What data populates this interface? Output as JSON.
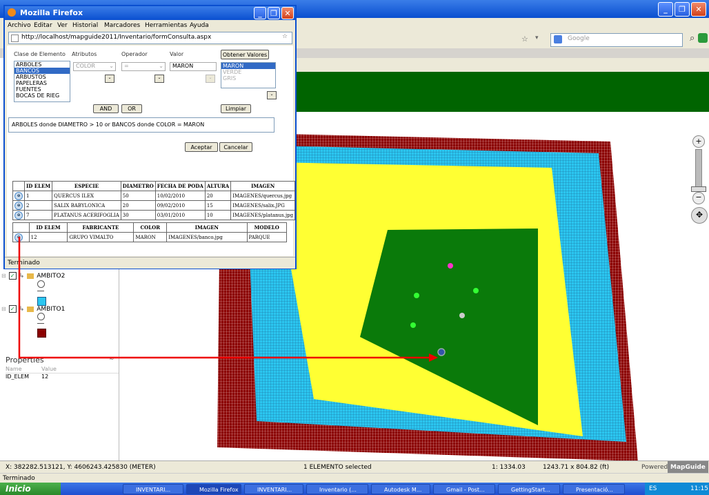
{
  "main_window": {
    "search_placeholder": "Google",
    "status_coords": "X: 382282.513121, Y: 4606243.425830 (METER)",
    "status_selected": "1 ELEMENTO selected",
    "status_scale": "1: 1334.03",
    "status_size": "1243.71 x 804.82 (ft)",
    "powered_by": "Powered by",
    "brand": "MapGuide",
    "bottom_status": "Terminado"
  },
  "legend": {
    "items": [
      {
        "label": "AMBITO2",
        "checked": true
      },
      {
        "label": "AMBITO1",
        "checked": true
      }
    ]
  },
  "properties": {
    "title": "Properties",
    "col_name": "Name",
    "col_value": "Value",
    "row_name": "ID_ELEM",
    "row_value": "12"
  },
  "popup": {
    "title": "Mozilla Firefox",
    "menu": [
      "Archivo",
      "Editar",
      "Ver",
      "Historial",
      "Marcadores",
      "Herramientas",
      "Ayuda"
    ],
    "url": "http://localhost/mapguide2011/Inventario/formConsulta.aspx",
    "labels": {
      "clase": "Clase de Elemento",
      "atributos": "Atributos",
      "operador": "Operador",
      "valor": "Valor"
    },
    "obtener_btn": "Obtener Valores",
    "clases": [
      "ARBOLES",
      "BANCOS",
      "ARBUSTOS",
      "PAPELERAS",
      "FUENTES",
      "BOCAS DE RIEG"
    ],
    "selected_clase": "BANCOS",
    "atributo_value": "COLOR",
    "operador_value": "=",
    "valor_input": "MARON",
    "valores": [
      "MARON",
      "VERDE",
      "GRIS"
    ],
    "and_btn": "AND",
    "or_btn": "OR",
    "limpiar_btn": "Limpiar",
    "query": "ARBOLES donde DIAMETRO > 10 or BANCOS donde COLOR = MARON",
    "aceptar_btn": "Aceptar",
    "cancelar_btn": "Cancelar",
    "status": "Terminado",
    "table1": {
      "headers": [
        "ID ELEM",
        "ESPECIE",
        "DIAMETRO",
        "FECHA DE PODA",
        "ALTURA",
        "IMAGEN"
      ],
      "rows": [
        [
          "1",
          "QUERCUS ILEX",
          "50",
          "10/02/2010",
          "20",
          "IMAGENES/quercus.jpg"
        ],
        [
          "2",
          "SALIX BABYLONICA",
          "20",
          "09/02/2010",
          "15",
          "IMAGENES/salix.JPG"
        ],
        [
          "7",
          "PLATANUS ACERIFOGLIA",
          "30",
          "03/01/2010",
          "10",
          "IMAGENES/platanus.jpg"
        ]
      ]
    },
    "table2": {
      "headers": [
        "ID ELEM",
        "FABRICANTE",
        "COLOR",
        "IMAGEN",
        "MODELO"
      ],
      "rows": [
        [
          "12",
          "GRUPO VIMALTO",
          "MARON",
          "IMAGENES/banco.jpg",
          "PARQUE"
        ]
      ]
    }
  },
  "taskbar": {
    "start": "Inicio",
    "tasks": [
      "INVENTARI...",
      "Mozilla Firefox",
      "INVENTARI...",
      "Inventario (...",
      "Autodesk M...",
      "Gmail - Post...",
      "GettingStart...",
      "Presentació..."
    ],
    "lang": "ES",
    "time": "11:15"
  }
}
